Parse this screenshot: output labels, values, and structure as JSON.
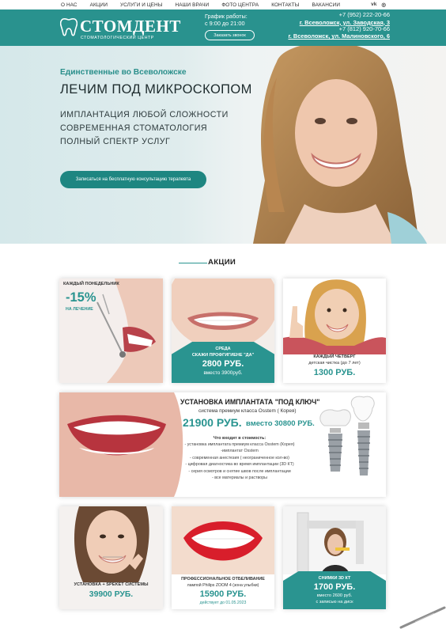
{
  "nav": {
    "items": [
      "О НАС",
      "АКЦИИ",
      "УСЛУГИ И ЦЕНЫ",
      "НАШИ ВРАЧИ",
      "ФОТО ЦЕНТРА",
      "КОНТАКТЫ",
      "ВАКАНСИИ"
    ],
    "vk": "vk",
    "instagram": "◎"
  },
  "header": {
    "brand": "СТОМДЕНТ",
    "brand_sub": "СТОМАТОЛОГИЧЕСКИЙ ЦЕНТР",
    "schedule_label": "График работы:",
    "schedule_hours": "с 9:00 до 21:00",
    "call_button": "Заказать звонок",
    "phone1": "+7 (952) 222-20-66",
    "address1": "г. Всеволожск, ул. Заводская, 3",
    "phone2": "+7 (812) 920-70-66",
    "address2": "г. Всеволожск, ул. Малиновского, 6"
  },
  "hero": {
    "kicker": "Единственные во Всеволожске",
    "headline": "ЛЕЧИМ ПОД МИКРОСКОПОМ",
    "bullets": [
      "ИМПЛАНТАЦИЯ ЛЮБОЙ СЛОЖНОСТИ",
      "СОВРЕМЕННАЯ СТОМАТОЛОГИЯ",
      "ПОЛНЫЙ СПЕКТР УСЛУГ"
    ],
    "cta": "Записаться на бесплатную консультацию терапевта"
  },
  "promos": {
    "title": "АКЦИИ",
    "monday": {
      "label": "КАЖДЫЙ ПОНЕДЕЛЬНИК",
      "discount": "-15%",
      "note": "НА ЛЕЧЕНИЕ"
    },
    "wednesday": {
      "day": "СРЕДА",
      "phrase": "СКАЖИ ПРОФГИГИЕНЕ \"ДА\"",
      "price": "2800 РУБ.",
      "old": "вместо 3900руб."
    },
    "thursday": {
      "day": "КАЖДЫЙ ЧЕТВЕРГ",
      "desc": "детская чистка (до 7 лет)",
      "price": "1300 РУБ."
    },
    "implant": {
      "title": "УСТАНОВКА ИМПЛАНТАТА \"ПОД КЛЮЧ\"",
      "system": "система премиум класса Osstem ( Корея)",
      "price": "21900 РУБ.",
      "old": "вместо 30800 РУБ.",
      "includes_title": "Что входит в стоимость:",
      "includes": [
        "- установка имплантата премиум класса Osstem (Корея)",
        "-имплантат Osstem",
        "- современная анестезия ( неограниченное кол-во)",
        "- цифровая диагностика во время имплантации (3D КТ)",
        "- серия осмотров и снятие швов после имплантации",
        "- все материалы и растворы"
      ]
    },
    "braces": {
      "title": "УСТАНОВКА + SPEKET СИСТЕМЫ",
      "price": "39900 РУБ."
    },
    "whitening": {
      "title": "ПРОФЕССИОНАЛЬНОЕ ОТБЕЛИВАНИЕ",
      "desc": "лампой Philips ZOOM 4 (зона улыбки)",
      "price": "15900 РУБ.",
      "until": "действует до 01.05.2023"
    },
    "ct": {
      "title": "СНИМКИ 3D КТ",
      "price": "1700 РУБ.",
      "old": "вместо 2600 руб.",
      "extra": "с записью на диск"
    }
  },
  "colors": {
    "accent": "#29928e",
    "dark": "#1d2b2d"
  }
}
